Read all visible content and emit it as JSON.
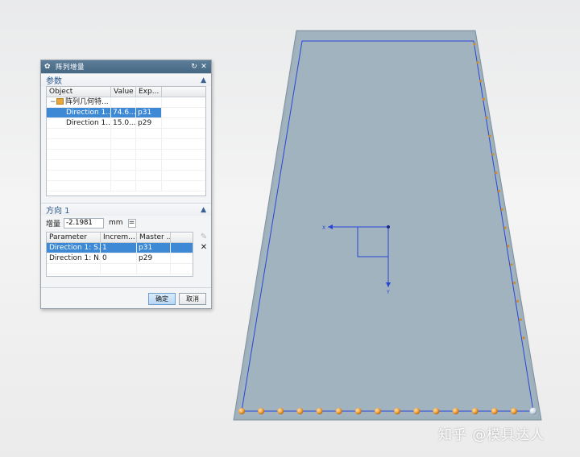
{
  "dialog": {
    "title": "阵列增量",
    "params_group": {
      "title": "参数",
      "columns": [
        "Object",
        "Value",
        "Exp..."
      ],
      "root_label": "阵列几何特...",
      "rows": [
        {
          "object": "Direction 1...",
          "value": "74.6...",
          "exp": "p31",
          "selected": true
        },
        {
          "object": "Direction 1...",
          "value": "15.0...",
          "exp": "p29",
          "selected": false
        }
      ]
    },
    "direction_group": {
      "title": "方向 1",
      "increment_label": "增量",
      "increment_value": "-2.1981",
      "unit": "mm",
      "equals_btn": "=",
      "columns": [
        "Parameter",
        "Increm...",
        "Master ..."
      ],
      "rows": [
        {
          "param": "Direction 1: S...",
          "incr": "1",
          "master": "p31",
          "selected": true
        },
        {
          "param": "Direction 1: N...",
          "incr": "0",
          "master": "p29",
          "selected": false
        }
      ]
    },
    "ok_label": "确定",
    "cancel_label": "取消"
  },
  "axes": {
    "x_label": "X",
    "y_label": "Y"
  },
  "watermark": "知乎 @模具达人",
  "colors": {
    "plate_fill": "#9db0bc",
    "plate_edge": "#7f919d",
    "sketch_line": "#2846d6",
    "point_orange": "#f2a444",
    "title_bar": "#4f708c",
    "selection": "#3d89d6"
  }
}
